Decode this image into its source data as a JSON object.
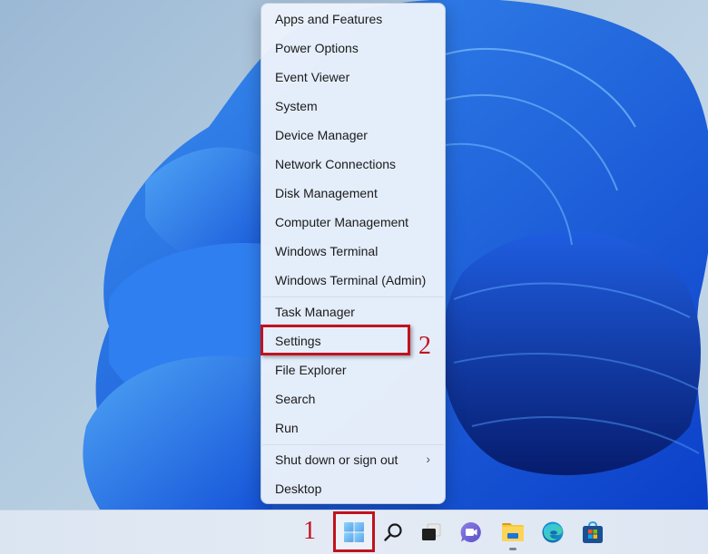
{
  "context_menu": {
    "items": [
      {
        "label": "Apps and Features"
      },
      {
        "label": "Power Options"
      },
      {
        "label": "Event Viewer"
      },
      {
        "label": "System"
      },
      {
        "label": "Device Manager"
      },
      {
        "label": "Network Connections"
      },
      {
        "label": "Disk Management"
      },
      {
        "label": "Computer Management"
      },
      {
        "label": "Windows Terminal"
      },
      {
        "label": "Windows Terminal (Admin)"
      },
      {
        "label": "Task Manager"
      },
      {
        "label": "Settings"
      },
      {
        "label": "File Explorer"
      },
      {
        "label": "Search"
      },
      {
        "label": "Run"
      },
      {
        "label": "Shut down or sign out",
        "submenu_icon": "chevron-right-icon",
        "submenu_glyph": "›"
      },
      {
        "label": "Desktop"
      }
    ]
  },
  "annotations": {
    "step1": "1",
    "step2": "2",
    "highlight_color": "#c1121f"
  },
  "taskbar": {
    "icons": [
      {
        "name": "start",
        "icon": "windows-start-icon"
      },
      {
        "name": "search",
        "icon": "search-icon"
      },
      {
        "name": "task-view",
        "icon": "task-view-icon"
      },
      {
        "name": "teams-chat",
        "icon": "teams-chat-icon"
      },
      {
        "name": "file-explorer",
        "icon": "folder-icon",
        "running": true
      },
      {
        "name": "edge",
        "icon": "edge-browser-icon"
      },
      {
        "name": "microsoft-store",
        "icon": "store-icon"
      }
    ]
  }
}
